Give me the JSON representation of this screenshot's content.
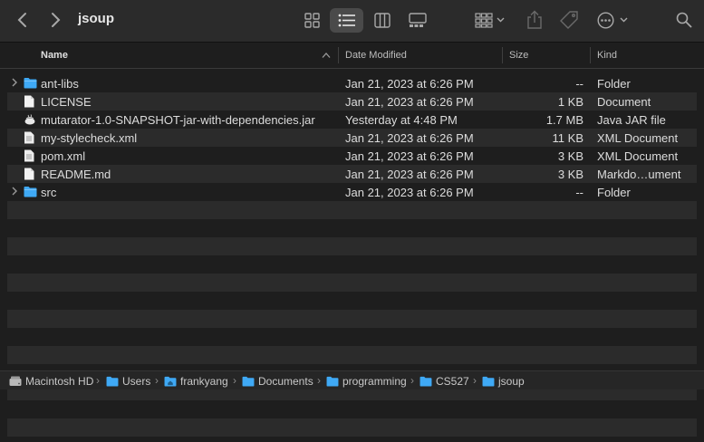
{
  "window": {
    "title": "jsoup"
  },
  "columns": {
    "name": "Name",
    "date": "Date Modified",
    "size": "Size",
    "kind": "Kind"
  },
  "files": [
    {
      "name": "ant-libs",
      "date": "Jan 21, 2023 at 6:26 PM",
      "size": "--",
      "kind": "Folder",
      "icon": "folder-icon",
      "expandable": true
    },
    {
      "name": "LICENSE",
      "date": "Jan 21, 2023 at 6:26 PM",
      "size": "1 KB",
      "kind": "Document",
      "icon": "document-icon",
      "expandable": false
    },
    {
      "name": "mutarator-1.0-SNAPSHOT-jar-with-dependencies.jar",
      "date": "Yesterday at 4:48 PM",
      "size": "1.7 MB",
      "kind": "Java JAR file",
      "icon": "jar-icon",
      "expandable": false
    },
    {
      "name": "my-stylecheck.xml",
      "date": "Jan 21, 2023 at 6:26 PM",
      "size": "11 KB",
      "kind": "XML Document",
      "icon": "xml-document-icon",
      "expandable": false
    },
    {
      "name": "pom.xml",
      "date": "Jan 21, 2023 at 6:26 PM",
      "size": "3 KB",
      "kind": "XML Document",
      "icon": "xml-document-icon",
      "expandable": false
    },
    {
      "name": "README.md",
      "date": "Jan 21, 2023 at 6:26 PM",
      "size": "3 KB",
      "kind": "Markdo…ument",
      "icon": "document-icon",
      "expandable": false
    },
    {
      "name": "src",
      "date": "Jan 21, 2023 at 6:26 PM",
      "size": "--",
      "kind": "Folder",
      "icon": "folder-icon",
      "expandable": true
    }
  ],
  "pathbar": [
    {
      "label": "Macintosh HD",
      "icon": "hard-drive-icon"
    },
    {
      "label": "Users",
      "icon": "folder-icon"
    },
    {
      "label": "frankyang",
      "icon": "home-folder-icon"
    },
    {
      "label": "Documents",
      "icon": "folder-icon"
    },
    {
      "label": "programming",
      "icon": "folder-icon"
    },
    {
      "label": "CS527",
      "icon": "folder-icon"
    },
    {
      "label": "jsoup",
      "icon": "folder-icon"
    }
  ],
  "colors": {
    "folder": "#3fa9f5",
    "selection": "#4a4a4a",
    "stripe": "#2b2b2b"
  }
}
